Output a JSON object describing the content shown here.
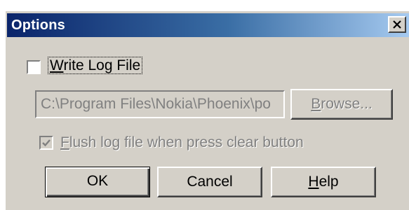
{
  "window": {
    "title": "Options"
  },
  "write_log": {
    "checked": false,
    "label_first": "W",
    "label_rest": "rite Log File"
  },
  "path_field": {
    "value": "C:\\Program Files\\Nokia\\Phoenix\\po"
  },
  "browse_button": {
    "label_first": "B",
    "label_rest": "rowse..."
  },
  "flush_option": {
    "checked": true,
    "enabled": false,
    "label_first": "F",
    "label_rest": "lush log file when press clear button"
  },
  "buttons": {
    "ok": "OK",
    "cancel": "Cancel",
    "help_first": "H",
    "help_rest": "elp"
  },
  "icons": {
    "close": "close-icon",
    "checkmark": "checkmark-icon"
  },
  "colors": {
    "title_start": "#0a246a",
    "title_end": "#a6caf0",
    "face": "#d4d0c8",
    "disabled_text": "#808080"
  }
}
